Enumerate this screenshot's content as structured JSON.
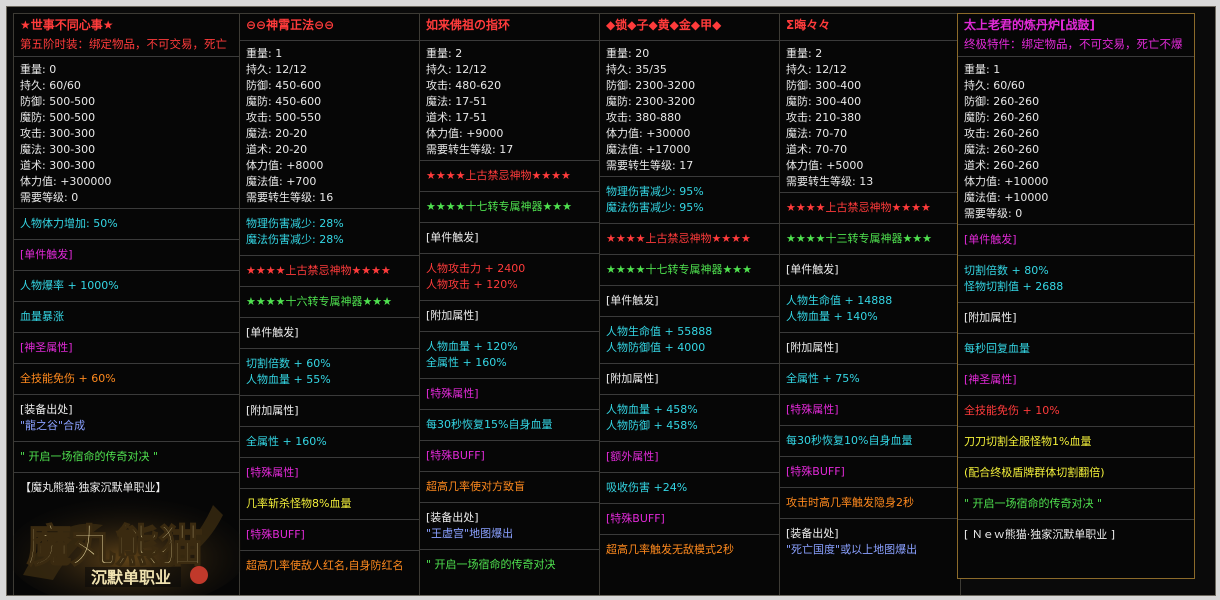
{
  "colors": {
    "red": "#ff3b3b",
    "cyan": "#34d6e4",
    "magenta": "#e22ad8",
    "white": "#eeeeee",
    "yellow": "#f2ef3a",
    "green": "#4fe14f",
    "orange": "#ff8a1e",
    "blue": "#8aa0ff",
    "purple": "#b87cff",
    "logo_gold": "#e9d9a0"
  },
  "cards": [
    {
      "title": "★世事不同心事★",
      "title_color": "#ff3b3b",
      "subtitle": "第五阶时装：绑定物品，不可交易，死亡",
      "stats": [
        "重量: 0",
        "持久: 60/60",
        "防御: 500-500",
        "魔防: 500-500",
        "攻击: 300-300",
        "魔法: 300-300",
        "道术: 300-300",
        "体力值: +300000",
        "需要等级: 0"
      ],
      "sections": [
        {
          "lines": [
            {
              "text": "人物体力增加: 50%",
              "color": "#34d6e4"
            }
          ]
        },
        {
          "lines": [
            {
              "text": "[单件触发]",
              "color": "#e22ad8"
            }
          ]
        },
        {
          "lines": [
            {
              "text": "人物爆率 + 1000%",
              "color": "#34d6e4"
            }
          ]
        },
        {
          "lines": [
            {
              "text": "血量暴涨",
              "color": "#34d6e4"
            }
          ]
        },
        {
          "lines": [
            {
              "text": "[神圣属性]",
              "color": "#e22ad8"
            }
          ]
        },
        {
          "lines": [
            {
              "text": "全技能免伤 + 60%",
              "color": "#ff8a1e"
            }
          ]
        },
        {
          "lines": [
            {
              "text": "[装备出处]",
              "color": "#eeeeee"
            },
            {
              "text": "\"龍之谷\"合成",
              "color": "#8aa0ff"
            }
          ]
        },
        {
          "lines": [
            {
              "text": "\"  开启一场宿命的传奇对决  \"",
              "color": "#4fe14f"
            }
          ]
        },
        {
          "lines": [
            {
              "text": "【魔丸熊猫·独家沉默单职业】",
              "color": "#eeeeee"
            }
          ]
        }
      ]
    },
    {
      "title": "⊖⊖神霄正法⊖⊖",
      "title_color": "#ff3b3b",
      "subtitle": "",
      "stats": [
        "重量: 1",
        "持久: 12/12",
        "防御: 450-600",
        "魔防: 450-600",
        "攻击: 500-550",
        "魔法: 20-20",
        "道术: 20-20",
        "体力值: +8000",
        "魔法值: +700",
        "需要转生等级: 16"
      ],
      "sections": [
        {
          "lines": [
            {
              "text": "物理伤害减少: 28%",
              "color": "#34d6e4"
            },
            {
              "text": "魔法伤害减少: 28%",
              "color": "#34d6e4"
            }
          ]
        },
        {
          "lines": [
            {
              "text": "★★★★上古禁忌神物★★★★",
              "color": "#ff3b3b"
            }
          ]
        },
        {
          "lines": [
            {
              "text": "★★★★十六转专属神器★★★",
              "color": "#4fe14f"
            }
          ]
        },
        {
          "lines": [
            {
              "text": "[单件触发]",
              "color": "#eeeeee"
            }
          ]
        },
        {
          "lines": [
            {
              "text": "切割倍数 + 60%",
              "color": "#34d6e4"
            },
            {
              "text": "人物血量 + 55%",
              "color": "#34d6e4"
            }
          ]
        },
        {
          "lines": [
            {
              "text": "[附加属性]",
              "color": "#eeeeee"
            }
          ]
        },
        {
          "lines": [
            {
              "text": "全属性 + 160%",
              "color": "#34d6e4"
            }
          ]
        },
        {
          "lines": [
            {
              "text": "[特殊属性]",
              "color": "#e22ad8"
            }
          ]
        },
        {
          "lines": [
            {
              "text": "几率斩杀怪物8%血量",
              "color": "#f2ef3a"
            }
          ]
        },
        {
          "lines": [
            {
              "text": "[特殊BUFF]",
              "color": "#e22ad8"
            }
          ]
        },
        {
          "lines": [
            {
              "text": "超高几率使敌人红名,自身防红名",
              "color": "#ff8a1e"
            }
          ]
        }
      ]
    },
    {
      "title": "如来佛祖の指环",
      "title_color": "#ff3b3b",
      "subtitle": "",
      "stats": [
        "重量: 2",
        "持久: 12/12",
        "攻击: 480-620",
        "魔法: 17-51",
        "道术: 17-51",
        "体力值: +9000",
        "需要转生等级: 17"
      ],
      "sections": [
        {
          "lines": [
            {
              "text": "★★★★上古禁忌神物★★★★",
              "color": "#ff3b3b"
            }
          ]
        },
        {
          "lines": [
            {
              "text": "★★★★十七转专属神器★★★",
              "color": "#4fe14f"
            }
          ]
        },
        {
          "lines": [
            {
              "text": "[单件触发]",
              "color": "#eeeeee"
            }
          ]
        },
        {
          "lines": [
            {
              "text": "人物攻击力 + 2400",
              "color": "#ff3b3b"
            },
            {
              "text": "人物攻击 + 120%",
              "color": "#ff3b3b"
            }
          ]
        },
        {
          "lines": [
            {
              "text": "[附加属性]",
              "color": "#eeeeee"
            }
          ]
        },
        {
          "lines": [
            {
              "text": "人物血量 + 120%",
              "color": "#34d6e4"
            },
            {
              "text": "全属性 + 160%",
              "color": "#34d6e4"
            }
          ]
        },
        {
          "lines": [
            {
              "text": "[特殊属性]",
              "color": "#e22ad8"
            }
          ]
        },
        {
          "lines": [
            {
              "text": "每30秒恢复15%自身血量",
              "color": "#34d6e4"
            }
          ]
        },
        {
          "lines": [
            {
              "text": "[特殊BUFF]",
              "color": "#e22ad8"
            }
          ]
        },
        {
          "lines": [
            {
              "text": "超高几率使对方致盲",
              "color": "#ff8a1e"
            }
          ]
        },
        {
          "lines": [
            {
              "text": "[装备出处]",
              "color": "#eeeeee"
            },
            {
              "text": "\"王虚宫\"地图爆出",
              "color": "#8aa0ff"
            }
          ]
        },
        {
          "lines": [
            {
              "text": "\"  开启一场宿命的传奇对决",
              "color": "#4fe14f"
            }
          ]
        }
      ]
    },
    {
      "title": "◆锁◆子◆黄◆金◆甲◆",
      "title_color": "#ff3b3b",
      "subtitle": "",
      "stats": [
        "重量: 20",
        "持久: 35/35",
        "防御: 2300-3200",
        "魔防: 2300-3200",
        "攻击: 380-880",
        "体力值: +30000",
        "魔法值: +17000",
        "需要转生等级: 17"
      ],
      "sections": [
        {
          "lines": [
            {
              "text": "物理伤害减少: 95%",
              "color": "#34d6e4"
            },
            {
              "text": "魔法伤害减少: 95%",
              "color": "#34d6e4"
            }
          ]
        },
        {
          "lines": [
            {
              "text": "★★★★上古禁忌神物★★★★",
              "color": "#ff3b3b"
            }
          ]
        },
        {
          "lines": [
            {
              "text": "★★★★十七转专属神器★★★",
              "color": "#4fe14f"
            }
          ]
        },
        {
          "lines": [
            {
              "text": "[单件触发]",
              "color": "#eeeeee"
            }
          ]
        },
        {
          "lines": [
            {
              "text": "人物生命值 + 55888",
              "color": "#34d6e4"
            },
            {
              "text": "人物防御值 + 4000",
              "color": "#34d6e4"
            }
          ]
        },
        {
          "lines": [
            {
              "text": "[附加属性]",
              "color": "#eeeeee"
            }
          ]
        },
        {
          "lines": [
            {
              "text": "人物血量 + 458%",
              "color": "#34d6e4"
            },
            {
              "text": "人物防御 + 458%",
              "color": "#34d6e4"
            }
          ]
        },
        {
          "lines": [
            {
              "text": "[额外属性]",
              "color": "#e22ad8"
            }
          ]
        },
        {
          "lines": [
            {
              "text": "吸收伤害 +24%",
              "color": "#34d6e4"
            }
          ]
        },
        {
          "lines": [
            {
              "text": "[特殊BUFF]",
              "color": "#e22ad8"
            }
          ]
        },
        {
          "lines": [
            {
              "text": "超高几率触发无敌模式2秒",
              "color": "#ff8a1e"
            }
          ]
        }
      ]
    },
    {
      "title": "Σ晦々々",
      "title_color": "#ff3b3b",
      "subtitle": "",
      "stats": [
        "重量: 2",
        "持久: 12/12",
        "防御: 300-400",
        "魔防: 300-400",
        "攻击: 210-380",
        "魔法: 70-70",
        "道术: 70-70",
        "体力值: +5000",
        "需要转生等级: 13"
      ],
      "sections": [
        {
          "lines": [
            {
              "text": "★★★★上古禁忌神物★★★★",
              "color": "#ff3b3b"
            }
          ]
        },
        {
          "lines": [
            {
              "text": "★★★★十三转专属神器★★★",
              "color": "#4fe14f"
            }
          ]
        },
        {
          "lines": [
            {
              "text": "[单件触发]",
              "color": "#eeeeee"
            }
          ]
        },
        {
          "lines": [
            {
              "text": "人物生命值 + 14888",
              "color": "#34d6e4"
            },
            {
              "text": "人物血量 + 140%",
              "color": "#34d6e4"
            }
          ]
        },
        {
          "lines": [
            {
              "text": "[附加属性]",
              "color": "#eeeeee"
            }
          ]
        },
        {
          "lines": [
            {
              "text": "全属性 + 75%",
              "color": "#34d6e4"
            }
          ]
        },
        {
          "lines": [
            {
              "text": "[特殊属性]",
              "color": "#e22ad8"
            }
          ]
        },
        {
          "lines": [
            {
              "text": "每30秒恢复10%自身血量",
              "color": "#34d6e4"
            }
          ]
        },
        {
          "lines": [
            {
              "text": "[特殊BUFF]",
              "color": "#e22ad8"
            }
          ]
        },
        {
          "lines": [
            {
              "text": "攻击时高几率触发隐身2秒",
              "color": "#ff8a1e"
            }
          ]
        },
        {
          "lines": [
            {
              "text": "[装备出处]",
              "color": "#eeeeee"
            },
            {
              "text": "\"死亡国度\"或以上地图爆出",
              "color": "#8aa0ff"
            }
          ]
        }
      ]
    },
    {
      "title": "太上老君的炼丹炉[战鼓]",
      "title_color": "#e22ad8",
      "subtitle": "终极特件：绑定物品，不可交易，死亡不爆",
      "stats": [
        "重量: 1",
        "持久: 60/60",
        "防御: 260-260",
        "魔防: 260-260",
        "攻击: 260-260",
        "魔法: 260-260",
        "道术: 260-260",
        "体力值: +10000",
        "魔法值: +10000",
        "需要等级: 0"
      ],
      "sections": [
        {
          "lines": [
            {
              "text": "[单件触发]",
              "color": "#e22ad8"
            }
          ]
        },
        {
          "lines": [
            {
              "text": "切割倍数 + 80%",
              "color": "#34d6e4"
            },
            {
              "text": "怪物切割值 + 2688",
              "color": "#34d6e4"
            }
          ]
        },
        {
          "lines": [
            {
              "text": "[附加属性]",
              "color": "#eeeeee"
            }
          ]
        },
        {
          "lines": [
            {
              "text": "每秒回复血量",
              "color": "#34d6e4"
            }
          ]
        },
        {
          "lines": [
            {
              "text": "[神圣属性]",
              "color": "#e22ad8"
            }
          ]
        },
        {
          "lines": [
            {
              "text": "全技能免伤 + 10%",
              "color": "#ff3b3b"
            }
          ]
        },
        {
          "lines": [
            {
              "text": "刀刀切割全服怪物1%血量",
              "color": "#f2ef3a"
            }
          ]
        },
        {
          "lines": [
            {
              "text": "(配合终极盾牌群体切割翻倍)",
              "color": "#f2ef3a"
            }
          ]
        },
        {
          "lines": [
            {
              "text": "\"  开启一场宿命的传奇对决  \"",
              "color": "#4fe14f"
            }
          ]
        },
        {
          "lines": [
            {
              "text": "[  Ｎｅｗ熊猫·独家沉默单职业  ]",
              "color": "#eeeeee"
            }
          ]
        }
      ]
    }
  ],
  "logo": {
    "main": "魔丸熊猫",
    "sub": "沉默单职业"
  }
}
